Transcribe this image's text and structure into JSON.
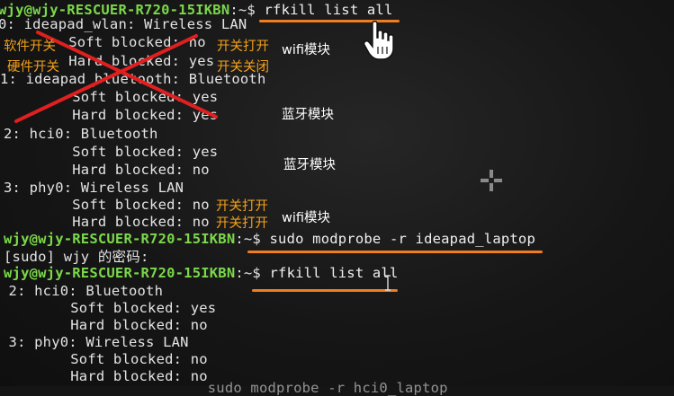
{
  "terminal": {
    "line1": {
      "prompt": "wjy@wjy-RESCUER-R720-15IKBN",
      "sep": ":~$",
      "cmd": " rfkill list all"
    },
    "line2": "0: ideapad_wlan: Wireless LAN",
    "line3": "        Soft blocked: no",
    "line4": "        Hard blocked: yes",
    "line5": "1: ideapad_bluetooth: Bluetooth",
    "line6": "        Soft blocked: yes",
    "line7": "        Hard blocked: yes",
    "line8": "2: hci0: Bluetooth",
    "line9": "        Soft blocked: yes",
    "line10": "        Hard blocked: no",
    "line11": "3: phy0: Wireless LAN",
    "line12": "        Soft blocked: no",
    "line13": "        Hard blocked: no",
    "line14": {
      "prompt": "wjy@wjy-RESCUER-R720-15IKBN",
      "sep": ":~$",
      "cmd": " sudo modprobe -r ideapad_laptop"
    },
    "line15": "[sudo] wjy 的密码:",
    "line16": {
      "prompt": "wjy@wjy-RESCUER-R720-15IKBN",
      "sep": ":~$",
      "cmd": " rfkill list all"
    },
    "line17": " 2: hci0: Bluetooth",
    "line18": "        Soft blocked: yes",
    "line19": "        Hard blocked: no",
    "line20": " 3: phy0: Wireless LAN",
    "line21": "        Soft blocked: no",
    "line22": "        Hard blocked: no",
    "line23": "                        sudo modprobe -r hci0_laptop"
  },
  "annotations": {
    "soft_switch": "软件开关",
    "hard_switch": "硬件开关",
    "switch_on_1": "开关打开",
    "switch_off": "开关关闭",
    "wifi_module_1": "wifi模块",
    "bt_module_1": "蓝牙模块",
    "bt_module_2": "蓝牙模块",
    "switch_on_2": "开关打开",
    "switch_on_3": "开关打开",
    "wifi_module_2": "wifi模块"
  },
  "colors": {
    "prompt_green": "#7bd84a",
    "annotation_orange": "#f4a018",
    "underline_orange": "#f07d1e",
    "cross_red": "#e02020"
  },
  "icons": {
    "cursor_hand": "hand-pointer-icon",
    "crosshair": "crosshair-cursor-icon"
  }
}
